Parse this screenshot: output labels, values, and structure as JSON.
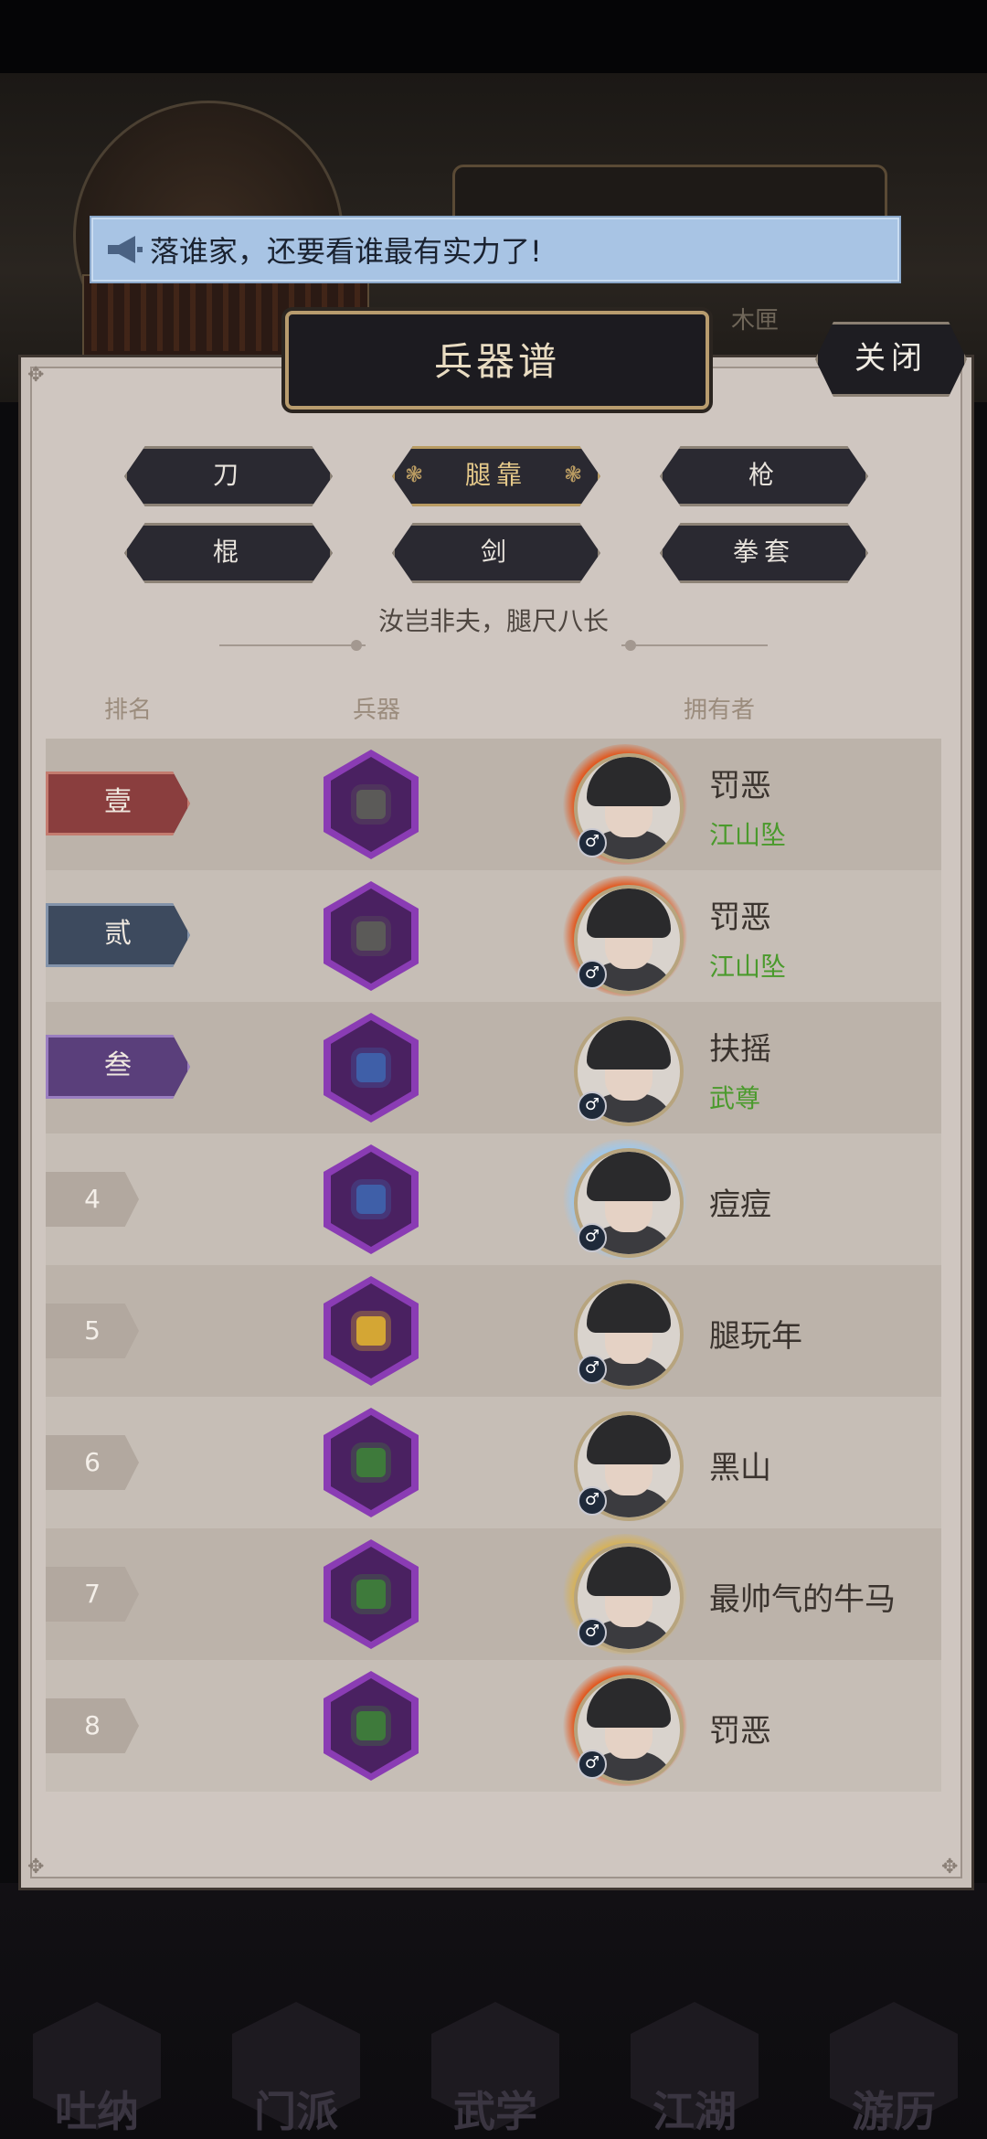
{
  "background": {
    "bg_text": "木匣",
    "nav": [
      "吐纳",
      "门派",
      "武学",
      "江湖",
      "游历"
    ]
  },
  "marquee": {
    "text": "落谁家，还要看谁最有实力了!"
  },
  "panel": {
    "title": "兵器谱",
    "close_label": "关闭"
  },
  "tabs": [
    {
      "label": "刀",
      "active": false
    },
    {
      "label": "腿靠",
      "active": true
    },
    {
      "label": "枪",
      "active": false
    },
    {
      "label": "棍",
      "active": false
    },
    {
      "label": "剑",
      "active": false
    },
    {
      "label": "拳套",
      "active": false
    }
  ],
  "motto": "汝岂非夫，腿尺八长",
  "headers": {
    "rank": "排名",
    "weapon": "兵器",
    "owner": "拥有者"
  },
  "rows": [
    {
      "rank": "壹",
      "owner": "罚恶",
      "sect": "江山坠",
      "weapon_color": "#5b5a58",
      "aura": "#e2561c"
    },
    {
      "rank": "贰",
      "owner": "罚恶",
      "sect": "江山坠",
      "weapon_color": "#5b5a58",
      "aura": "#e2561c"
    },
    {
      "rank": "叁",
      "owner": "扶摇",
      "sect": "武尊",
      "weapon_color": "#3f5fa8",
      "aura": ""
    },
    {
      "rank": "4",
      "owner": "痘痘",
      "sect": "",
      "weapon_color": "#3f5fa8",
      "aura": "#9fc7ea"
    },
    {
      "rank": "5",
      "owner": "腿玩年",
      "sect": "",
      "weapon_color": "#d4a634",
      "aura": ""
    },
    {
      "rank": "6",
      "owner": "黑山",
      "sect": "",
      "weapon_color": "#3e7a3b",
      "aura": ""
    },
    {
      "rank": "7",
      "owner": "最帅气的牛马",
      "sect": "",
      "weapon_color": "#3e7a3b",
      "aura": "#d6b259"
    },
    {
      "rank": "8",
      "owner": "罚恶",
      "sect": "",
      "weapon_color": "#3e7a3b",
      "aura": "#e2561c"
    }
  ]
}
